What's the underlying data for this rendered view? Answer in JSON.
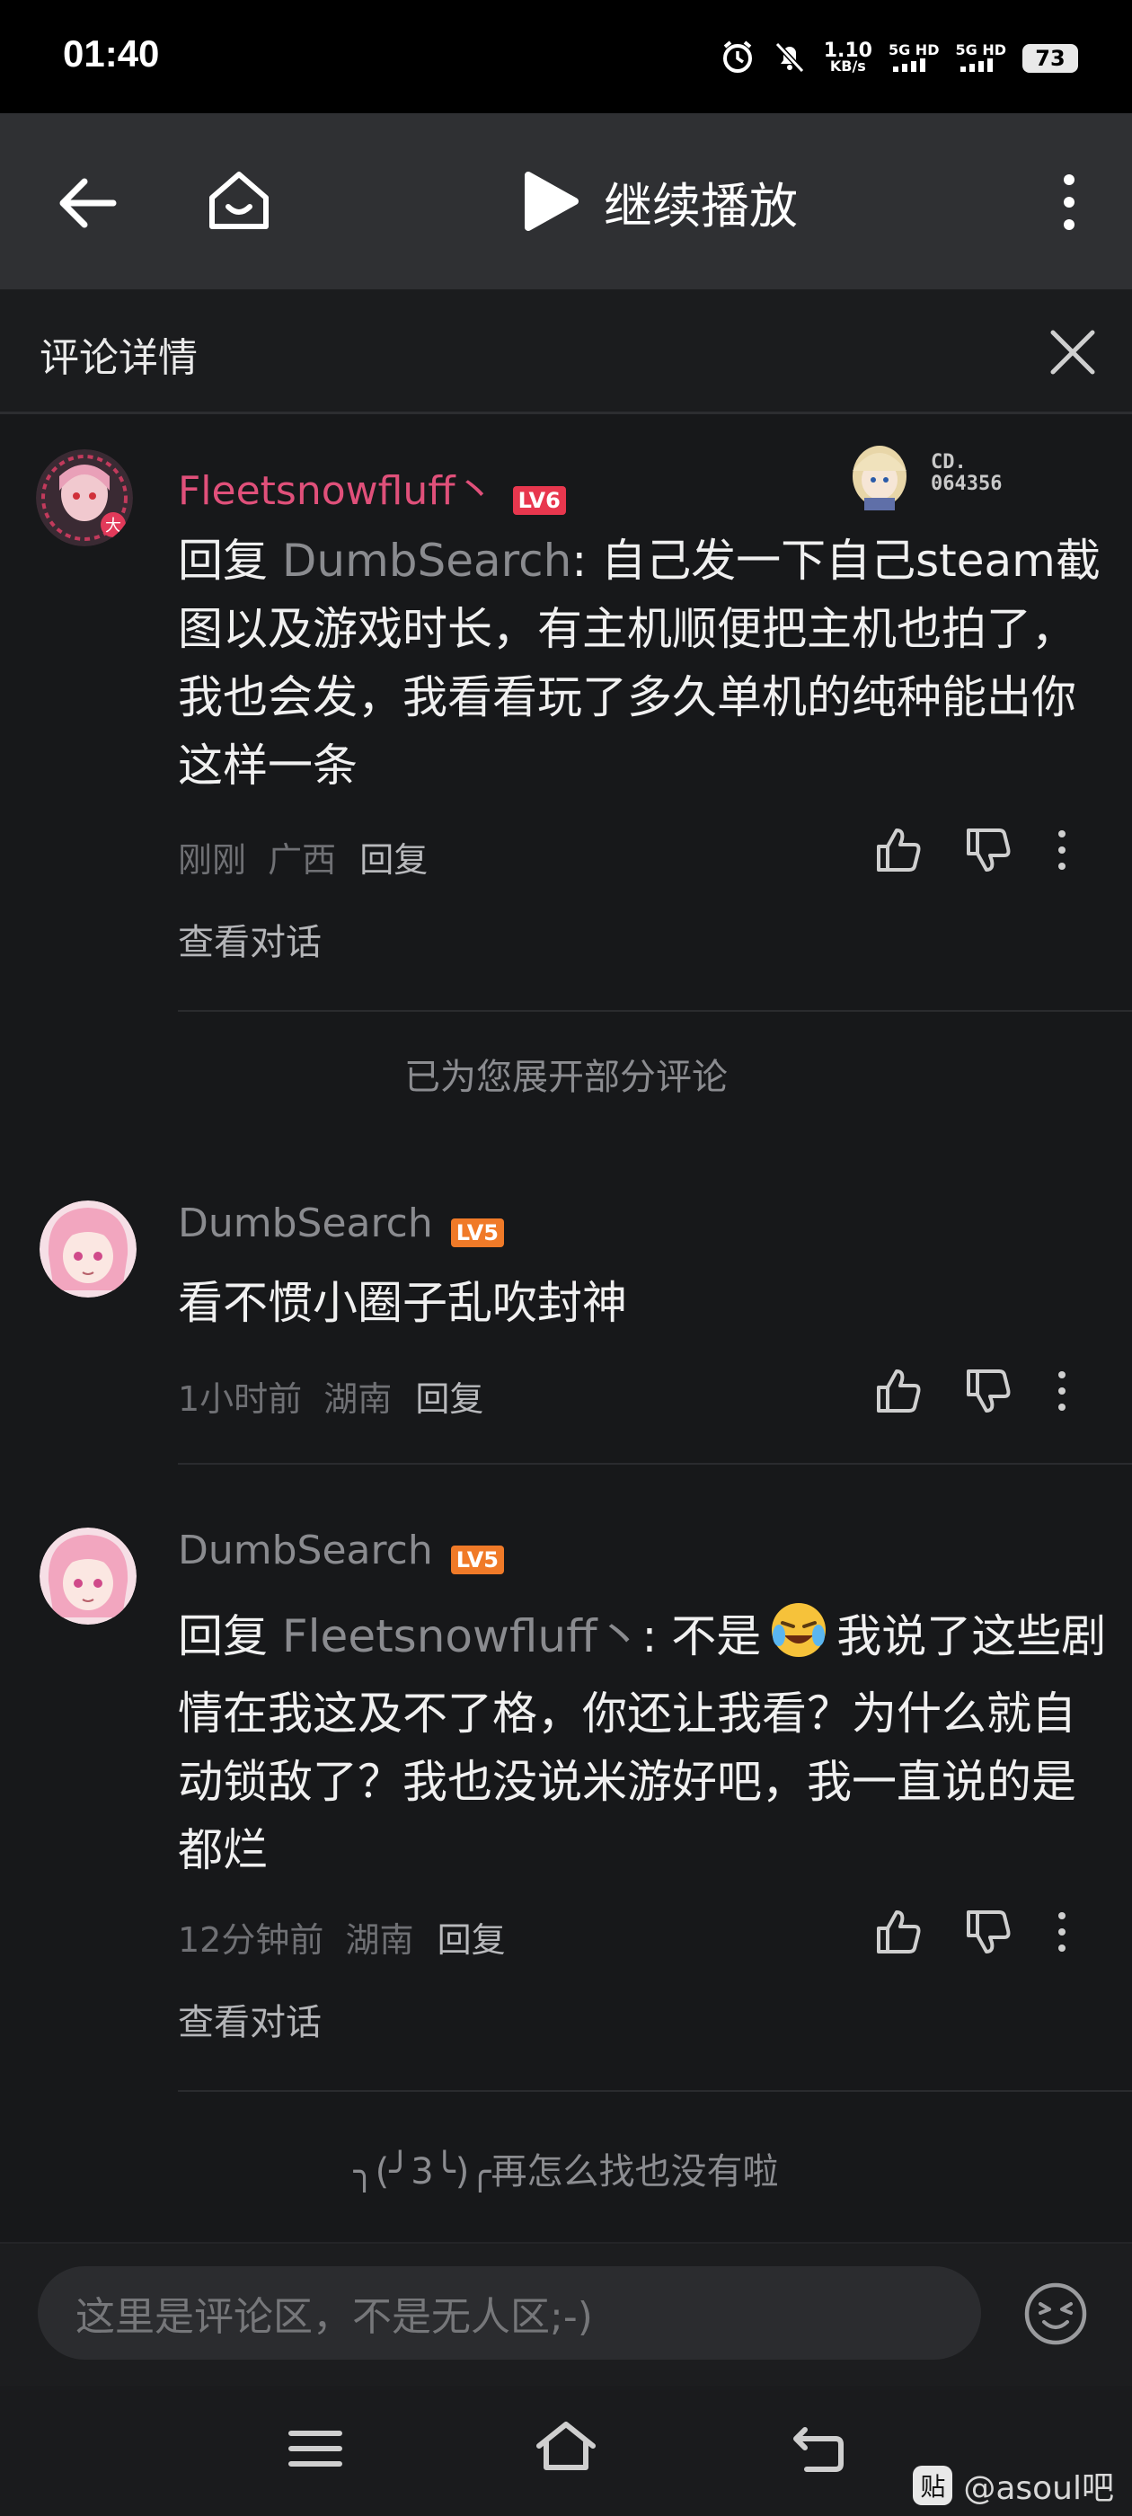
{
  "status_bar": {
    "time": "01:40",
    "net_speed_value": "1.10",
    "net_speed_unit": "KB/s",
    "sim1": "5G HD",
    "sim2": "5G HD",
    "battery": "73"
  },
  "top_bar": {
    "continue_label": "继续播放"
  },
  "panel": {
    "title": "评论详情"
  },
  "comments": [
    {
      "username": "Fleetsnowfluff丶",
      "level": "LV6",
      "level_color": "#e8374e",
      "name_color": "#e0507a",
      "badge_text_1": "CD.",
      "badge_text_2": "064356",
      "reply_prefix": "回复 ",
      "reply_target": "DumbSearch",
      "text": ": 自己发一下自己steam截图以及游戏时长，有主机顺便把主机也拍了，我也会发，我看看玩了多久单机的纯种能出你这样一条",
      "time": "刚刚",
      "location": "广西",
      "reply_label": "回复",
      "view_conversation": "查看对话"
    },
    {
      "username": "DumbSearch",
      "level": "LV5",
      "level_color": "#f07a28",
      "name_color": "#8a8b8f",
      "text": "看不惯小圈子乱吹封神",
      "time": "1小时前",
      "location": "湖南",
      "reply_label": "回复"
    },
    {
      "username": "DumbSearch",
      "level": "LV5",
      "level_color": "#f07a28",
      "name_color": "#8a8b8f",
      "reply_prefix": "回复 ",
      "reply_target": "Fleetsnowfluff丶",
      "text_before_emoji": ": 不是",
      "text_after_emoji": "我说了这些剧情在我这及不了格，你还让我看？为什么就自动锁敌了？我也没说米游好吧，我一直说的是都烂",
      "time": "12分钟前",
      "location": "湖南",
      "reply_label": "回复",
      "view_conversation": "查看对话"
    }
  ],
  "expanded_note": "已为您展开部分评论",
  "end_note": "╮(╯3╰)╭再怎么找也没有啦",
  "input": {
    "placeholder": "这里是评论区，不是无人区;-)"
  },
  "watermark": {
    "icon_text": "贴",
    "text": "@asoul吧"
  },
  "colors": {
    "background": "#17181a",
    "top_bar": "#2f3033",
    "reply_target": "#8a8b8f"
  }
}
